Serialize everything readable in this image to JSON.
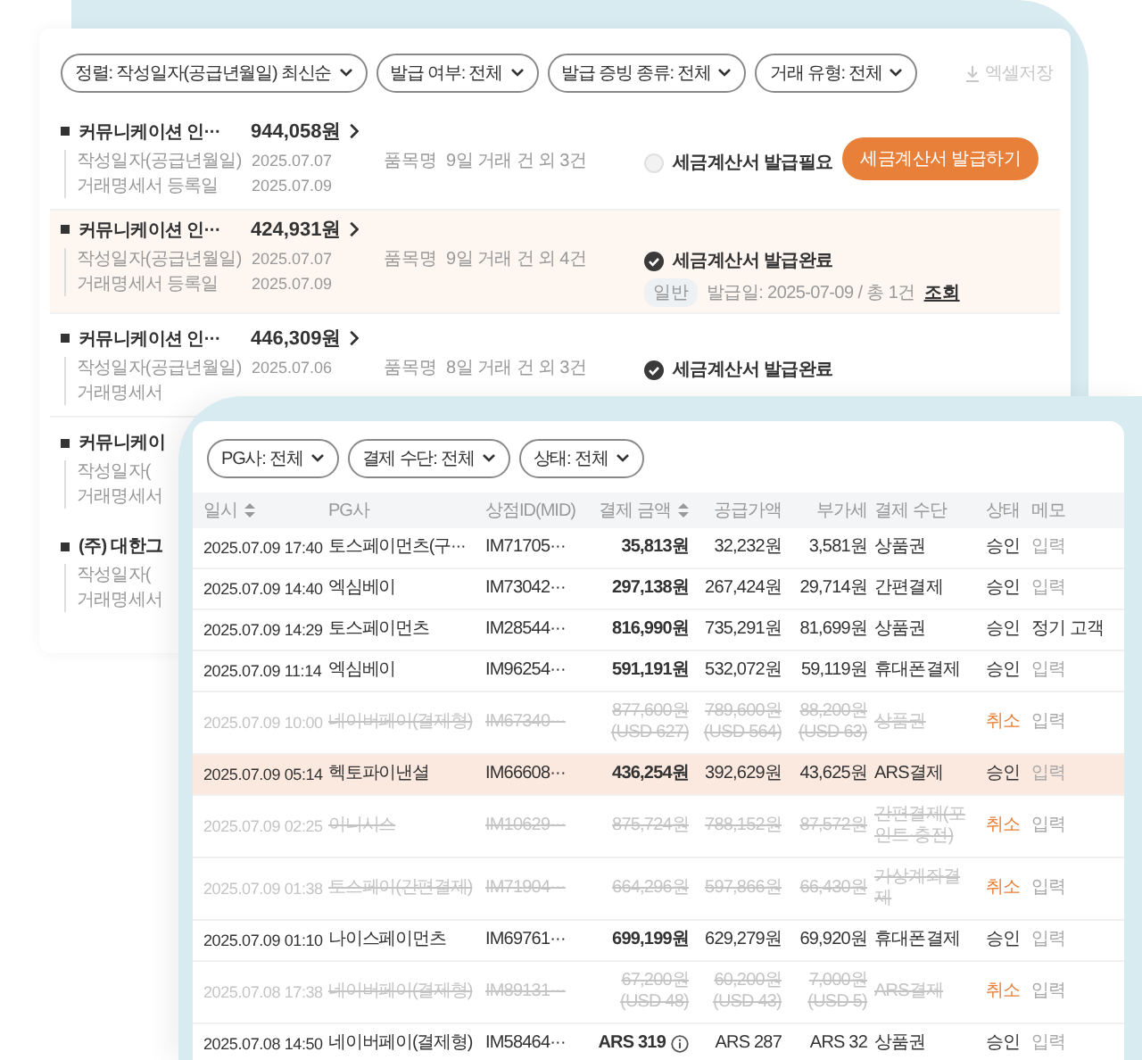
{
  "back_panel": {
    "filters": [
      {
        "label": "정렬: 작성일자(공급년월일) 최신순"
      },
      {
        "label": "발급 여부: 전체"
      },
      {
        "label": "발급 증빙 종류: 전체"
      },
      {
        "label": "거래 유형: 전체"
      }
    ],
    "excel_button": {
      "label": "엑셀저장",
      "disabled": true
    },
    "invoices": [
      {
        "name": "커뮤니케이션 인···",
        "amount": "944,058원",
        "selected": false,
        "lines": [
          {
            "label": "작성일자(공급년월일)",
            "value": "2025.07.07"
          },
          {
            "label": "거래명세서 등록일",
            "value": "2025.07.09"
          }
        ],
        "item": {
          "label": "품목명",
          "value": "9일 거래 건 외 3건"
        },
        "status": {
          "issued": false,
          "text": "세금계산서 발급필요"
        },
        "action": "세금계산서 발급하기"
      },
      {
        "name": "커뮤니케이션 인···",
        "amount": "424,931원",
        "selected": true,
        "lines": [
          {
            "label": "작성일자(공급년월일)",
            "value": "2025.07.07"
          },
          {
            "label": "거래명세서 등록일",
            "value": "2025.07.09"
          }
        ],
        "item": {
          "label": "품목명",
          "value": "9일 거래 건 외 4건"
        },
        "status": {
          "issued": true,
          "text": "세금계산서 발급완료"
        },
        "issue_info": {
          "tag": "일반",
          "text": "발급일: 2025-07-09 / 총 1건",
          "link": "조회"
        }
      },
      {
        "name": "커뮤니케이션 인···",
        "amount": "446,309원",
        "selected": false,
        "lines": [
          {
            "label": "작성일자(공급년월일)",
            "value": "2025.07.06"
          },
          {
            "label": "거래명세서"
          }
        ],
        "item": {
          "label": "품목명",
          "value": "8일 거래 건 외 3건"
        },
        "status": {
          "issued": true,
          "text": "세금계산서 발급완료"
        }
      },
      {
        "name": "커뮤니케이",
        "selected": false,
        "lines": [
          {
            "label": "작성일자("
          },
          {
            "label": "거래명세서"
          }
        ]
      },
      {
        "name": "(주) 대한그",
        "selected": false,
        "lines": [
          {
            "label": "작성일자("
          },
          {
            "label": "거래명세서"
          }
        ]
      }
    ]
  },
  "front_panel": {
    "filters": [
      {
        "label": "PG사: 전체"
      },
      {
        "label": "결제 수단: 전체"
      },
      {
        "label": "상태: 전체"
      }
    ],
    "columns": [
      {
        "label": "일시",
        "sortable": true
      },
      {
        "label": "PG사",
        "sortable": false
      },
      {
        "label": "상점ID(MID)",
        "sortable": false
      },
      {
        "label": "결제 금액",
        "sortable": true
      },
      {
        "label": "공급가액",
        "sortable": false
      },
      {
        "label": "부가세",
        "sortable": false
      },
      {
        "label": "결제 수단",
        "sortable": false
      },
      {
        "label": "상태",
        "sortable": false
      },
      {
        "label": "메모",
        "sortable": false
      }
    ],
    "rows": [
      {
        "time": "2025.07.09 17:40",
        "pg": "토스페이먼츠(구···",
        "mid": "IM71705···",
        "amount": [
          "35,813원"
        ],
        "supply": [
          "32,232원"
        ],
        "vat": [
          "3,581원"
        ],
        "method": "상품권",
        "status": "승인",
        "cancelled": false,
        "selected": false,
        "info": false,
        "memo": {
          "text": "입력",
          "filled": false
        }
      },
      {
        "time": "2025.07.09 14:40",
        "pg": "엑심베이",
        "mid": "IM73042···",
        "amount": [
          "297,138원"
        ],
        "supply": [
          "267,424원"
        ],
        "vat": [
          "29,714원"
        ],
        "method": "간편결제",
        "status": "승인",
        "cancelled": false,
        "selected": false,
        "info": false,
        "memo": {
          "text": "입력",
          "filled": false
        }
      },
      {
        "time": "2025.07.09 14:29",
        "pg": "토스페이먼츠",
        "mid": "IM28544···",
        "amount": [
          "816,990원"
        ],
        "supply": [
          "735,291원"
        ],
        "vat": [
          "81,699원"
        ],
        "method": "상품권",
        "status": "승인",
        "cancelled": false,
        "selected": false,
        "info": false,
        "memo": {
          "text": "정기 고객",
          "filled": true
        }
      },
      {
        "time": "2025.07.09 11:14",
        "pg": "엑심베이",
        "mid": "IM96254···",
        "amount": [
          "591,191원"
        ],
        "supply": [
          "532,072원"
        ],
        "vat": [
          "59,119원"
        ],
        "method": "휴대폰결제",
        "status": "승인",
        "cancelled": false,
        "selected": false,
        "info": false,
        "memo": {
          "text": "입력",
          "filled": false
        }
      },
      {
        "time": "2025.07.09 10:00",
        "pg": "네이버페이(결제형)",
        "mid": "IM67340···",
        "amount": [
          "877,600원",
          "(USD 627)"
        ],
        "supply": [
          "789,600원",
          "(USD 564)"
        ],
        "vat": [
          "88,200원",
          "(USD 63)"
        ],
        "method": "상품권",
        "status": "취소",
        "cancelled": true,
        "selected": false,
        "info": false,
        "memo": {
          "text": "입력",
          "filled": false
        }
      },
      {
        "time": "2025.07.09 05:14",
        "pg": "헥토파이낸셜",
        "mid": "IM66608···",
        "amount": [
          "436,254원"
        ],
        "supply": [
          "392,629원"
        ],
        "vat": [
          "43,625원"
        ],
        "method": "ARS결제",
        "status": "승인",
        "cancelled": false,
        "selected": true,
        "info": false,
        "memo": {
          "text": "입력",
          "filled": false
        }
      },
      {
        "time": "2025.07.09 02:25",
        "pg": "이니시스",
        "mid": "IM10629···",
        "amount": [
          "875,724원"
        ],
        "supply": [
          "788,152원"
        ],
        "vat": [
          "87,572원"
        ],
        "method": "간편결제(포인트·충전)",
        "status": "취소",
        "cancelled": true,
        "selected": false,
        "info": false,
        "memo": {
          "text": "입력",
          "filled": false
        }
      },
      {
        "time": "2025.07.09 01:38",
        "pg": "토스페이(간편결제)",
        "mid": "IM71904···",
        "amount": [
          "664,296원"
        ],
        "supply": [
          "597,866원"
        ],
        "vat": [
          "66,430원"
        ],
        "method": "가상계좌결제",
        "status": "취소",
        "cancelled": true,
        "selected": false,
        "info": false,
        "memo": {
          "text": "입력",
          "filled": false
        }
      },
      {
        "time": "2025.07.09 01:10",
        "pg": "나이스페이먼츠",
        "mid": "IM69761···",
        "amount": [
          "699,199원"
        ],
        "supply": [
          "629,279원"
        ],
        "vat": [
          "69,920원"
        ],
        "method": "휴대폰결제",
        "status": "승인",
        "cancelled": false,
        "selected": false,
        "info": false,
        "memo": {
          "text": "입력",
          "filled": false
        }
      },
      {
        "time": "2025.07.08 17:38",
        "pg": "네이버페이(결제형)",
        "mid": "IM89131···",
        "amount": [
          "67,200원",
          "(USD 48)"
        ],
        "supply": [
          "60,200원",
          "(USD 43)"
        ],
        "vat": [
          "7,000원",
          "(USD 5)"
        ],
        "method": "ARS결제",
        "status": "취소",
        "cancelled": true,
        "selected": false,
        "info": false,
        "memo": {
          "text": "입력",
          "filled": false
        }
      },
      {
        "time": "2025.07.08 14:50",
        "pg": "네이버페이(결제형)",
        "mid": "IM58464···",
        "amount": [
          "ARS 319"
        ],
        "supply": [
          "ARS 287"
        ],
        "vat": [
          "ARS 32"
        ],
        "method": "상품권",
        "status": "승인",
        "cancelled": false,
        "selected": false,
        "info": true,
        "memo": {
          "text": "입력",
          "filled": false
        }
      }
    ]
  }
}
